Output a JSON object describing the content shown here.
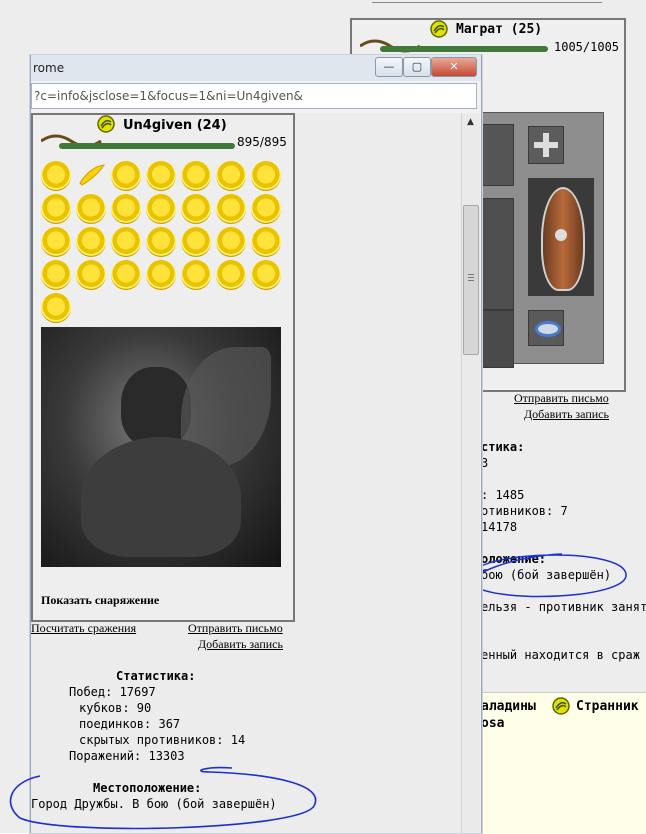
{
  "background_page": {
    "character": {
      "name": "Маграт (25)",
      "hp": "1005/1005"
    },
    "links": {
      "send_mail": "Отправить письмо",
      "add_entry": "Добавить запись"
    },
    "stats": {
      "heading": "стика:",
      "line1": "3",
      "line2": ": 1485",
      "line3": "отивников: 7",
      "line4": " 14178"
    },
    "location": {
      "heading": "оложение:",
      "value": "бою (бой завершён)",
      "notice1": "ельзя - противник занят",
      "notice2": "енный находится в сраж"
    },
    "clan": {
      "text1": "аладины",
      "text2": "Странник",
      "text3": "osa"
    }
  },
  "popup": {
    "title": "rome",
    "url": "?c=info&jsclose=1&focus=1&ni=Un4given&",
    "window_buttons": {
      "minimize": "—",
      "maximize": "▢",
      "close": "✕"
    },
    "character": {
      "name": "Un4given (24)",
      "hp": "895/895"
    },
    "show_equipment": "Показать снаряжение",
    "links": {
      "count_battles": "Посчитать сражения",
      "send_mail": "Отправить письмо",
      "add_entry": "Добавить запись"
    },
    "statistics": {
      "heading": "Статистика:",
      "wins": "Побед: 17697",
      "cups": "кубков: 90",
      "duels": "поединков: 367",
      "hidden": "скрытых противников: 14",
      "losses": "Поражений: 13303"
    },
    "location": {
      "heading": "Местоположение:",
      "value": "Город Дружбы. В бою (бой завершён)"
    }
  },
  "colors": {
    "annotation": "#1a2fd0",
    "hp_bar": "#3f7a3a"
  },
  "icons": [
    "clan-emblem-icon",
    "trophy-coin-icon",
    "scroll-up-icon",
    "scroll-down-icon"
  ]
}
